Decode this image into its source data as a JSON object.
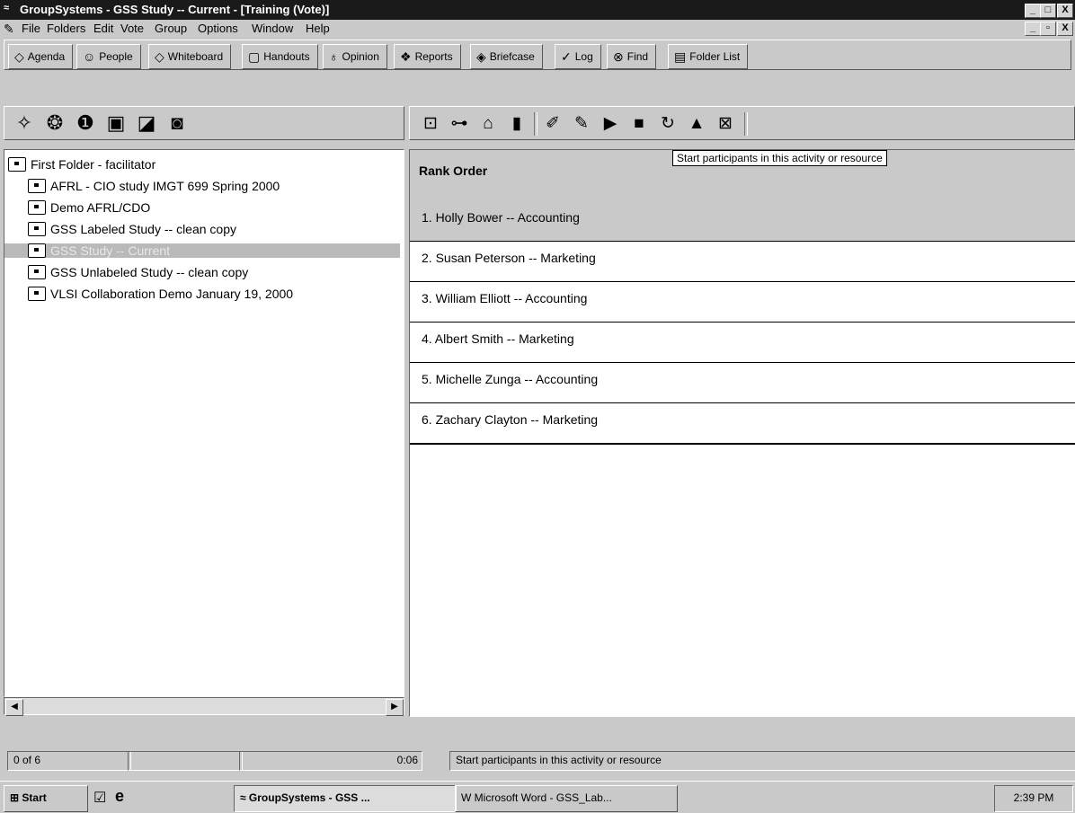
{
  "window": {
    "title": "GroupSystems - GSS Study -- Current - [Training (Vote)]",
    "app_icon": "gs-app-icon",
    "controls": [
      "_",
      "□",
      "X"
    ],
    "inner_controls": [
      "_",
      "▫",
      "X"
    ]
  },
  "menu": [
    {
      "label": "File"
    },
    {
      "label": "Folders"
    },
    {
      "label": "Edit"
    },
    {
      "label": "Vote"
    },
    {
      "label": "Group"
    },
    {
      "label": "Options"
    },
    {
      "label": "Window"
    },
    {
      "label": "Help"
    }
  ],
  "tabs": [
    {
      "label": "Agenda",
      "icon": "agenda-icon"
    },
    {
      "label": "People",
      "icon": "people-icon"
    },
    {
      "label": "Whiteboard",
      "icon": "whiteboard-icon"
    },
    {
      "label": "Handouts",
      "icon": "handouts-icon"
    },
    {
      "label": "Opinion",
      "icon": "opinion-icon"
    },
    {
      "label": "Reports",
      "icon": "reports-icon"
    },
    {
      "label": "Briefcase",
      "icon": "briefcase-icon"
    },
    {
      "label": "Log",
      "icon": "log-icon"
    },
    {
      "label": "Find",
      "icon": "binoculars-icon"
    },
    {
      "label": "Folder List",
      "icon": "folder-list-icon"
    }
  ],
  "left_tools": [
    "new-folder-icon",
    "open-folder-icon",
    "info-icon",
    "save-icon",
    "export-icon",
    "screen-icon"
  ],
  "right_tools": [
    "preview-icon",
    "org-icon",
    "handshake-icon",
    "bar-chart-icon",
    "pen-icon",
    "edit-icon",
    "start-participants-icon",
    "stop-participants-icon",
    "refresh-icon",
    "chart-icon",
    "close-box-icon"
  ],
  "tree": {
    "root": "First Folder - facilitator",
    "items": [
      "AFRL - CIO study IMGT 699 Spring 2000",
      "Demo AFRL/CDO",
      "GSS Labeled Study -- clean copy",
      "GSS Study -- Current",
      "GSS Unlabeled Study -- clean copy",
      "VLSI Collaboration Demo January 19, 2000"
    ]
  },
  "rank": {
    "header": "Rank Order",
    "items": [
      "1. Holly Bower -- Accounting",
      "2. Susan Peterson -- Marketing",
      "3. William Elliott -- Accounting",
      "4. Albert Smith  -- Marketing",
      "5. Michelle Zunga -- Accounting",
      "6. Zachary Clayton -- Marketing"
    ]
  },
  "tooltip": "Start participants in this activity or resource",
  "status": {
    "count": "0 of 6",
    "time": "0:06",
    "message": "Start participants in this activity or resource"
  },
  "taskbar": {
    "start": "Start",
    "tasks": [
      "GroupSystems - GSS ...",
      "Microsoft Word - GSS_Lab..."
    ],
    "clock": "2:39 PM"
  }
}
